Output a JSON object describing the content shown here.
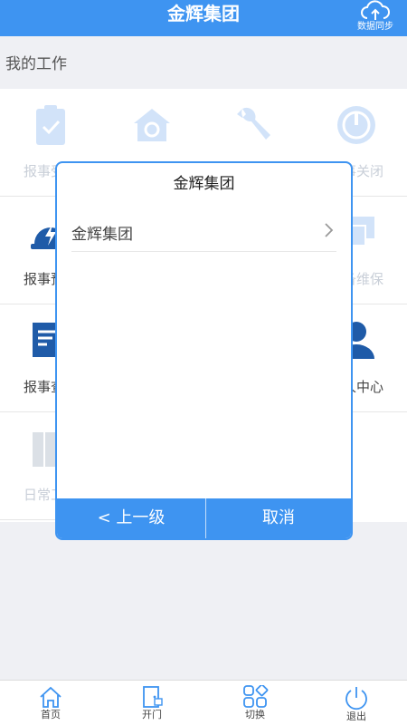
{
  "header": {
    "title": "金辉集团",
    "sync_label": "数据同步"
  },
  "section": {
    "title": "我的工作"
  },
  "grid": [
    {
      "label": "报事受理"
    },
    {
      "label": ""
    },
    {
      "label": ""
    },
    {
      "label": "报事关闭"
    },
    {
      "label": "报事预警"
    },
    {
      "label": ""
    },
    {
      "label": ""
    },
    {
      "label": "设备维保"
    },
    {
      "label": "报事查询"
    },
    {
      "label": ""
    },
    {
      "label": ""
    },
    {
      "label": "个人中心"
    },
    {
      "label": "日常工作"
    }
  ],
  "dialog": {
    "title": "金辉集团",
    "items": [
      {
        "label": "金辉集团"
      }
    ],
    "back_label": "< 上一级",
    "cancel_label": "取消"
  },
  "tabbar": [
    {
      "label": "首页",
      "icon": "home-icon"
    },
    {
      "label": "开门",
      "icon": "door-icon"
    },
    {
      "label": "切换",
      "icon": "switch-icon"
    },
    {
      "label": "退出",
      "icon": "power-icon"
    }
  ],
  "colors": {
    "primary": "#3e94f1",
    "dark_blue": "#1f5ba8"
  }
}
